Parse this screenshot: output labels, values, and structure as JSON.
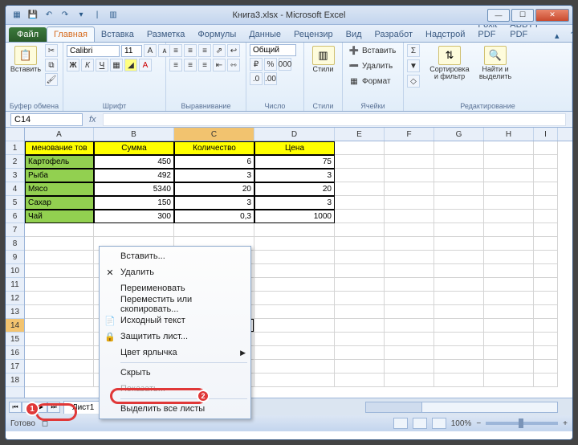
{
  "title": "Книга3.xlsx - Microsoft Excel",
  "ribbon": {
    "file": "Файл",
    "tabs": [
      "Главная",
      "Вставка",
      "Разметка",
      "Формулы",
      "Данные",
      "Рецензир",
      "Вид",
      "Разработ",
      "Надстрой",
      "Foxit PDF",
      "ABBYY PDF"
    ],
    "active": 0,
    "groups": {
      "clipboard": {
        "label": "Буфер обмена",
        "paste": "Вставить"
      },
      "font": {
        "label": "Шрифт",
        "name": "Calibri",
        "size": "11"
      },
      "align": {
        "label": "Выравнивание"
      },
      "number": {
        "label": "Число",
        "format": "Общий"
      },
      "styles": {
        "label": "Стили",
        "btn": "Стили"
      },
      "cells": {
        "label": "Ячейки",
        "insert": "Вставить",
        "delete": "Удалить",
        "format": "Формат"
      },
      "edit": {
        "label": "Редактирование",
        "sort": "Сортировка и фильтр",
        "find": "Найти и выделить"
      }
    }
  },
  "namebox": "C14",
  "columns": [
    "A",
    "B",
    "C",
    "D",
    "E",
    "F",
    "G",
    "H",
    "I"
  ],
  "table": {
    "headers": [
      "менование тов",
      "Сумма",
      "Количество",
      "Цена"
    ],
    "rows": [
      {
        "name": "Картофель",
        "sum": "450",
        "qty": "6",
        "price": "75"
      },
      {
        "name": "Рыба",
        "sum": "492",
        "qty": "3",
        "price": "3"
      },
      {
        "name": "Мясо",
        "sum": "5340",
        "qty": "20",
        "price": "20"
      },
      {
        "name": "Сахар",
        "sum": "150",
        "qty": "3",
        "price": "3"
      },
      {
        "name": "Чай",
        "sum": "300",
        "qty": "0,3",
        "price": "1000"
      }
    ]
  },
  "context_menu": [
    {
      "label": "Вставить...",
      "icon": ""
    },
    {
      "label": "Удалить",
      "icon": "✕"
    },
    {
      "label": "Переименовать",
      "icon": ""
    },
    {
      "label": "Переместить или скопировать...",
      "icon": ""
    },
    {
      "label": "Исходный текст",
      "icon": "📄"
    },
    {
      "label": "Защитить лист...",
      "icon": "🔒"
    },
    {
      "label": "Цвет ярлычка",
      "icon": "",
      "arrow": true
    },
    {
      "label": "Скрыть",
      "icon": ""
    },
    {
      "label": "Показать...",
      "icon": "",
      "disabled": true
    },
    {
      "label": "Выделить все листы",
      "icon": ""
    }
  ],
  "sheet_tab": "Лист1",
  "status": "Готово",
  "zoom": "100%",
  "callouts": {
    "c1": "1",
    "c2": "2"
  }
}
